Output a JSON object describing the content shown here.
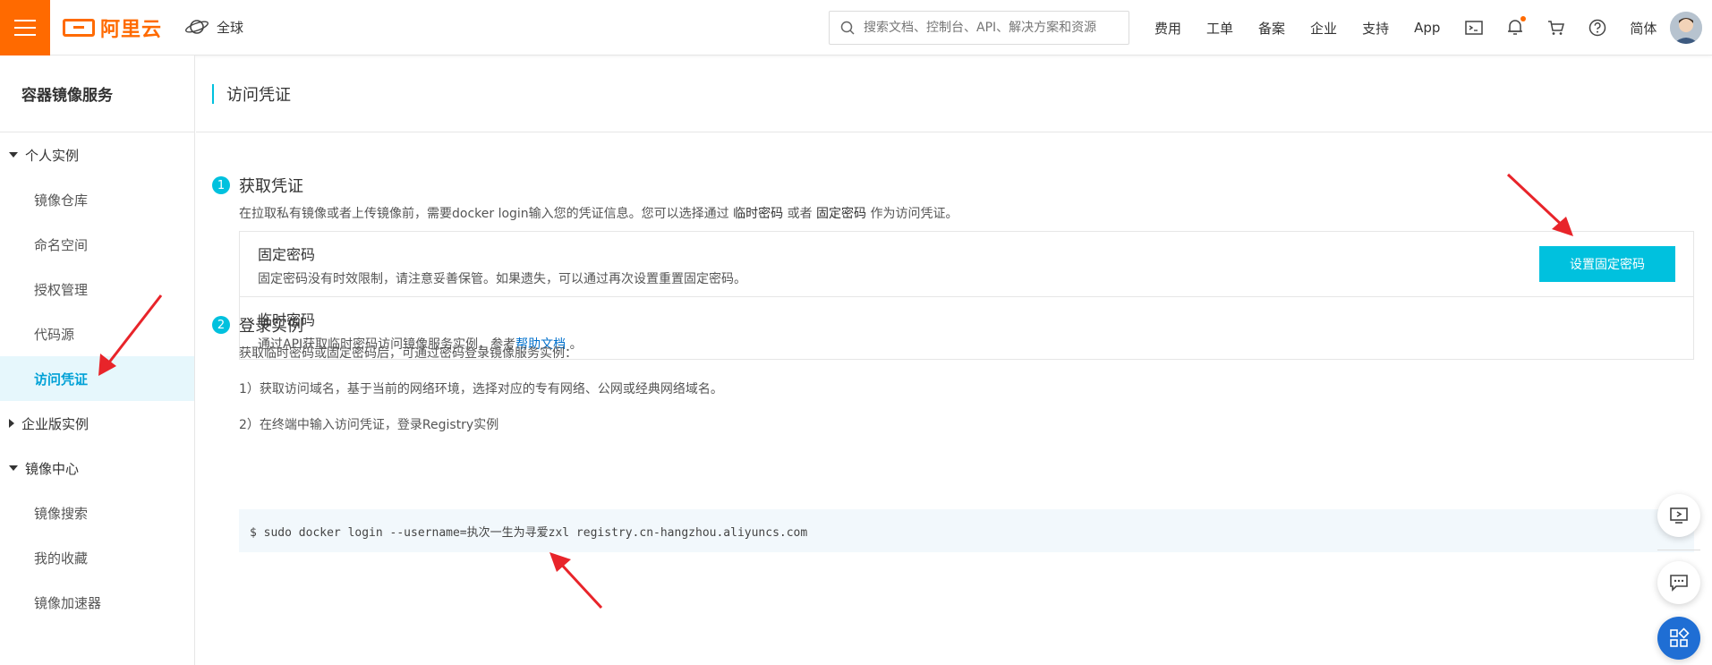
{
  "topbar": {
    "logo_text": "阿里云",
    "region_label": "全球",
    "search_placeholder": "搜索文档、控制台、API、解决方案和资源",
    "links": [
      "费用",
      "工单",
      "备案",
      "企业",
      "支持",
      "App"
    ],
    "language": "简体"
  },
  "sidebar": {
    "title": "容器镜像服务",
    "groups": [
      {
        "label": "个人实例",
        "expanded": true,
        "items": [
          "镜像仓库",
          "命名空间",
          "授权管理",
          "代码源",
          "访问凭证"
        ]
      },
      {
        "label": "企业版实例",
        "expanded": false,
        "items": []
      },
      {
        "label": "镜像中心",
        "expanded": true,
        "items": [
          "镜像搜索",
          "我的收藏",
          "镜像加速器"
        ]
      }
    ],
    "active_item": "访问凭证"
  },
  "main": {
    "page_title": "访问凭证",
    "step1": {
      "num": "1",
      "title": "获取凭证",
      "desc_pre": "在拉取私有镜像或者上传镜像前，需要docker login输入您的凭证信息。您可以选择通过",
      "desc_temp": "临时密码",
      "desc_or": "或者",
      "desc_fixed": "固定密码",
      "desc_post": "作为访问凭证。",
      "fixed": {
        "title": "固定密码",
        "desc": "固定密码没有时效限制，请注意妥善保管。如果遗失，可以通过再次设置重置固定密码。",
        "button": "设置固定密码"
      },
      "temp": {
        "title": "临时密码",
        "desc_pre": "通过API获取临时密码访问镜像服务实例，参考",
        "link": "帮助文档",
        "desc_post": "。"
      }
    },
    "step2": {
      "num": "2",
      "title": "登录实例",
      "desc": "获取临时密码或固定密码后，可通过密码登录镜像服务实例：",
      "line1": "1）获取访问域名，基于当前的网络环境，选择对应的专有网络、公网或经典网络域名。",
      "line2": "2）在终端中输入访问凭证，登录Registry实例",
      "command": "$ sudo docker login --username=执次一生为寻爱zxl registry.cn-hangzhou.aliyuncs.com"
    }
  },
  "colors": {
    "brand": "#ff6a00",
    "accent": "#00c1de",
    "link": "#0070cc",
    "arrow": "#e8242a"
  }
}
